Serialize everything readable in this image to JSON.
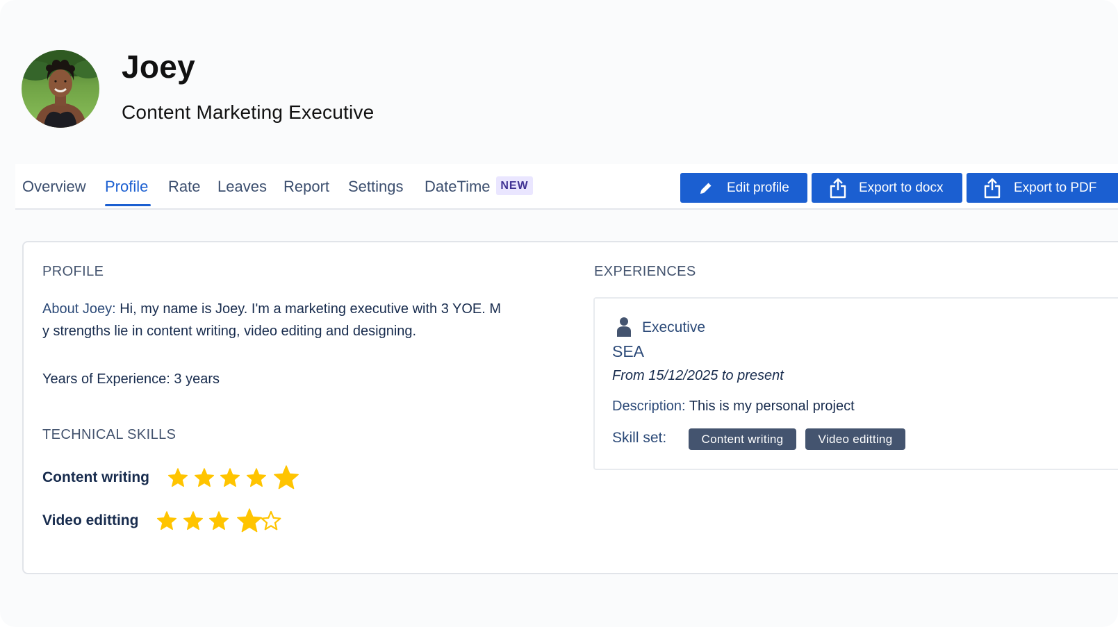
{
  "header": {
    "name": "Joey",
    "job_title": "Content Marketing Executive"
  },
  "tabs": [
    {
      "label": "Overview",
      "active": false
    },
    {
      "label": "Profile",
      "active": true
    },
    {
      "label": "Rate",
      "active": false
    },
    {
      "label": "Leaves",
      "active": false
    },
    {
      "label": "Report",
      "active": false
    },
    {
      "label": "Settings",
      "active": false
    },
    {
      "label": "DateTime",
      "active": false,
      "badge": "NEW"
    }
  ],
  "actions": {
    "edit_profile": {
      "label": "Edit profile",
      "icon": "pencil-icon"
    },
    "export_docx": {
      "label": "Export to docx",
      "icon": "share-export-icon"
    },
    "export_pdf": {
      "label": "Export to PDF",
      "icon": "share-export-icon"
    }
  },
  "profile": {
    "heading": "PROFILE",
    "about_label": "About Joey",
    "about_text_line1": "Hi, my name is Joey. I'm a marketing executive with 3 YOE. M",
    "about_text_line2": "y strengths lie in content writing, video editing and designing.",
    "yoe_label": "Years of Experience",
    "yoe_value": "3 years"
  },
  "technical_skills": {
    "heading": "TECHNICAL SKILLS",
    "max_rating": 5,
    "items": [
      {
        "name": "Content writing",
        "rating": 5
      },
      {
        "name": "Video editting",
        "rating": 4
      }
    ]
  },
  "experiences": {
    "heading": "EXPERIENCES",
    "items": [
      {
        "role": "Executive",
        "role_icon": "person-icon",
        "company": "SEA",
        "period": "From 15/12/2025 to present",
        "description_label": "Description",
        "description": "This is my personal project",
        "skill_set_label": "Skill set:",
        "skills": [
          "Content writing",
          "Video editting"
        ]
      }
    ]
  },
  "colors": {
    "primary": "#1b5fd1",
    "star": "#ffc400",
    "tag_bg": "#44546f",
    "badge_bg": "#eae6ff",
    "badge_text": "#403294"
  }
}
